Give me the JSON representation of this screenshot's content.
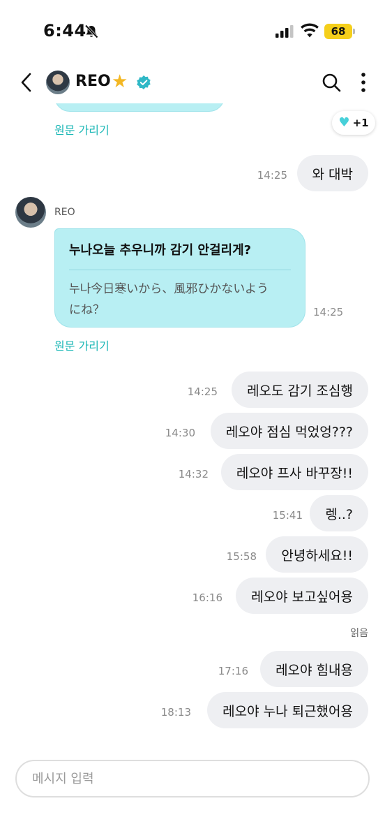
{
  "status_bar": {
    "time": "6:44",
    "battery": "68"
  },
  "header": {
    "name": "REO",
    "badge_icon": "star-icon",
    "verified_icon": "verified-icon"
  },
  "chat": {
    "hide_original_label": "원문 가리기",
    "reaction": {
      "icon": "heart-icon",
      "color": "#47d0d9",
      "count": "+1"
    },
    "sender_name": "REO",
    "incoming": {
      "text": "누나오늘 추우니까 감기 안걸리게?",
      "translation_line1": "누나今日寒いから、風邪ひかないよう",
      "translation_line2": "にね？",
      "time": "14:25"
    },
    "outgoing": [
      {
        "text": "와 대박",
        "time": "14:25"
      },
      {
        "text": "레오도 감기 조심행",
        "time": "14:25"
      },
      {
        "text": "레오야 점심 먹었엉???",
        "time": "14:30"
      },
      {
        "text": "레오야 프사 바꾸장!!",
        "time": "14:32"
      },
      {
        "text": "렝..?",
        "time": "15:41"
      },
      {
        "text": "안녕하세요!!",
        "time": "15:58"
      },
      {
        "text": "레오야 보고싶어용",
        "time": "16:16"
      },
      {
        "text": "레오야 힘내용",
        "time": "17:16"
      },
      {
        "text": "레오야 누나 퇴근했어용",
        "time": "18:13"
      }
    ],
    "read_label": "읽음"
  },
  "input": {
    "placeholder": "메시지 입력"
  },
  "colors": {
    "accent": "#1bb7b6",
    "incoming_bubble": "#b8eff3",
    "outgoing_bubble": "#eeeff2",
    "star": "#f3b723",
    "battery": "#f5cf1b"
  }
}
